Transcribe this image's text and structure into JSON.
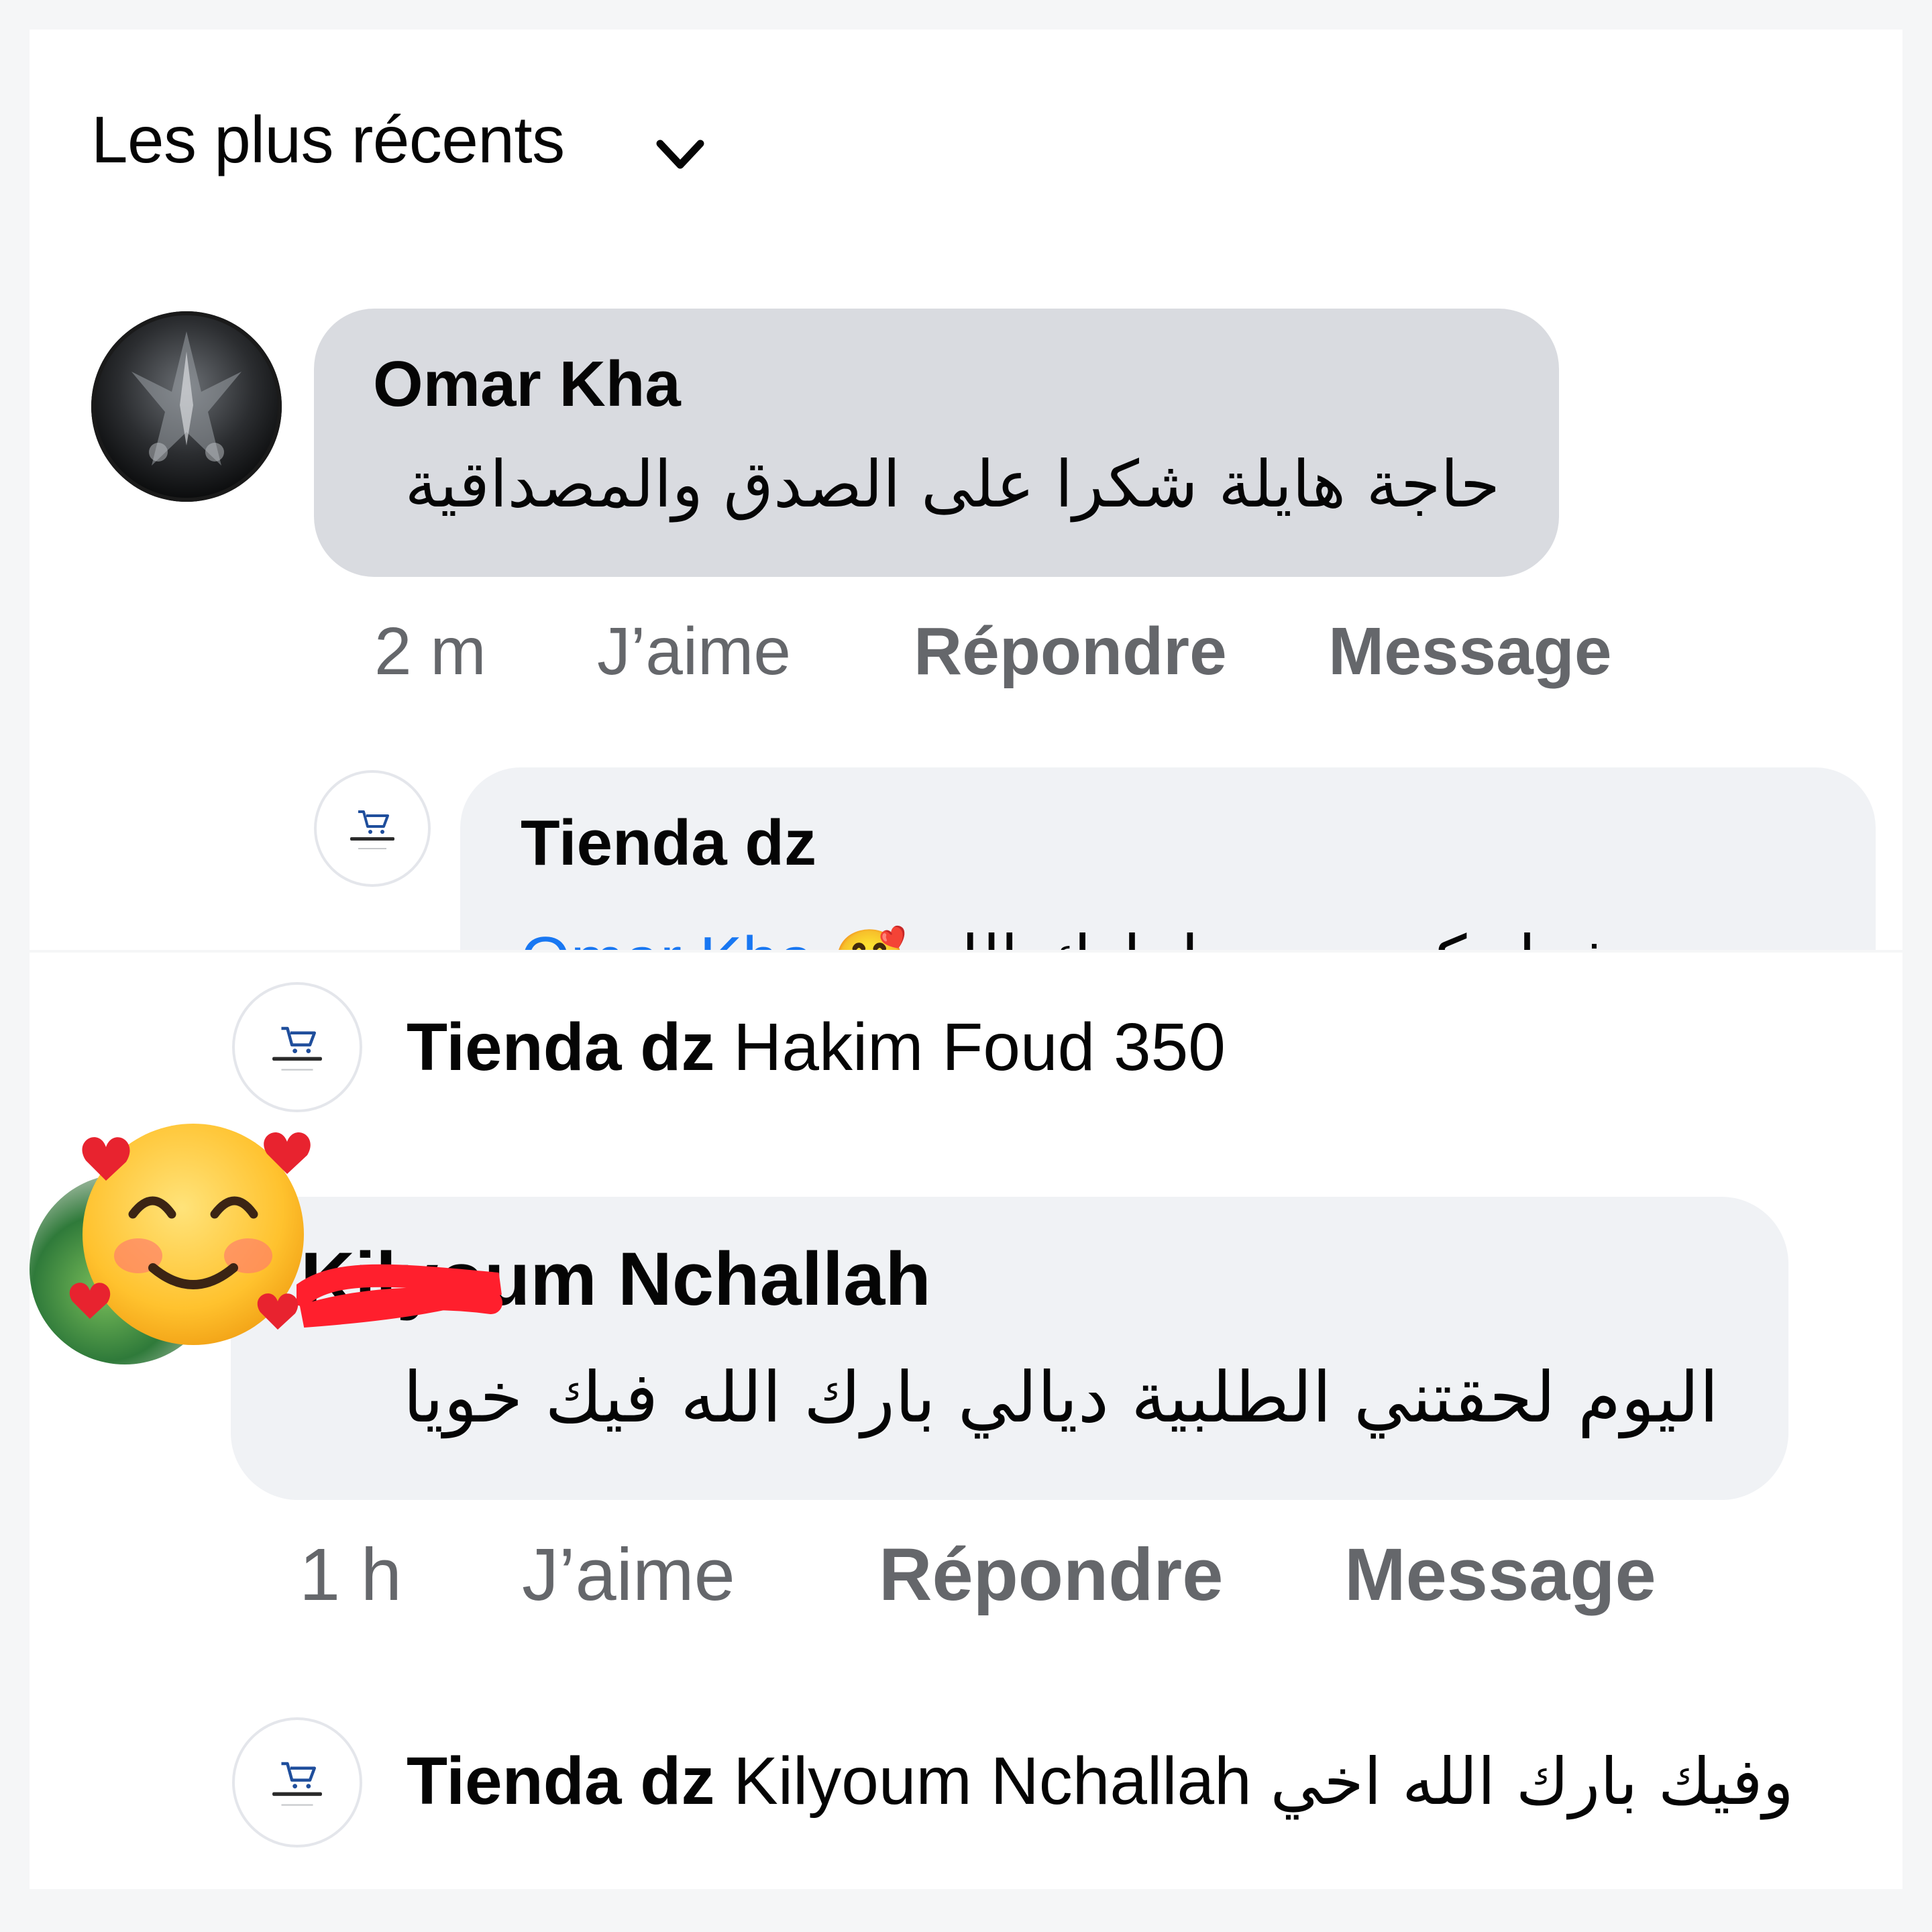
{
  "sort": {
    "label": "Les plus récents"
  },
  "icons": {
    "chevron": "chevron-down-icon",
    "emoji": "smiling-face-with-hearts-icon",
    "cart": "cart-logo-icon"
  },
  "colors": {
    "bubble_gray": "#d9dbe0",
    "bubble_light": "#f0f2f5",
    "meta": "#65676b",
    "link": "#1877f2"
  },
  "comment1": {
    "author": "Omar Kha",
    "text": "حاجة هايلة شكرا على الصدق والمصداقية",
    "time": "2 m",
    "like": "J’aime",
    "reply": "Répondre",
    "message": "Message",
    "reply_partial": {
      "author": "Tienda dz",
      "mention": "Omar Kha",
      "text": "شهادتكم نعتز بها بارك الله"
    }
  },
  "thread1": {
    "author": "Tienda dz",
    "text": "Hakim Foud 350"
  },
  "comment2": {
    "author": "Kilyoum Nchallah",
    "text": "اليوم لحقتني الطلبية ديالي بارك الله فيك خويا",
    "time": "1 h",
    "like": "J’aime",
    "reply": "Répondre",
    "message": "Message"
  },
  "thread2": {
    "author": "Tienda dz",
    "mention": "Kilyoum Nchallah",
    "text": "وفيك بارك الله اخي"
  }
}
